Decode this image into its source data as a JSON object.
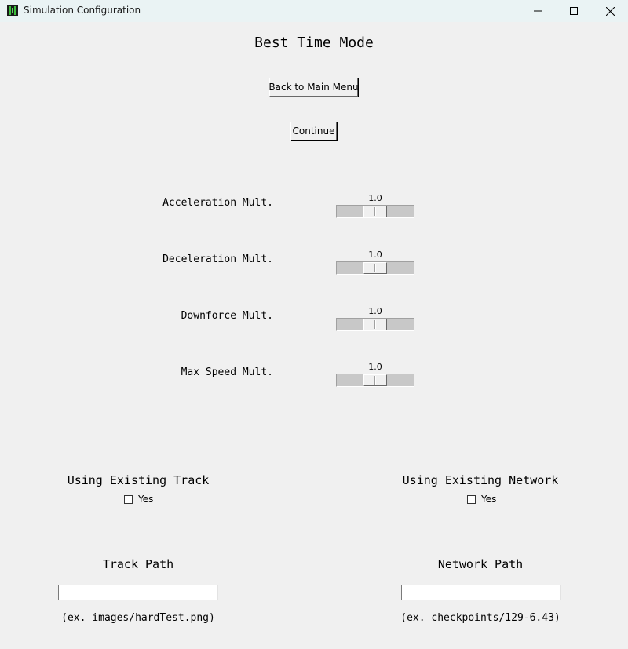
{
  "window": {
    "title": "Simulation Configuration",
    "icon": "app-icon",
    "controls": [
      "minimize-icon",
      "maximize-icon",
      "close-icon"
    ]
  },
  "page": {
    "heading": "Best Time Mode",
    "back_button_label": "Back to Main Menu",
    "continue_button_label": "Continue"
  },
  "sliders": [
    {
      "label": "Acceleration Mult.",
      "value": "1.0",
      "level": 0.5
    },
    {
      "label": "Deceleration Mult.",
      "value": "1.0",
      "level": 0.5
    },
    {
      "label": "Downforce Mult.",
      "value": "1.0",
      "level": 0.5
    },
    {
      "label": "Max Speed Mult.",
      "value": "1.0",
      "level": 0.5
    }
  ],
  "track": {
    "heading": "Using Existing Track",
    "checkbox_label": "Yes",
    "checked": false,
    "path_heading": "Track Path",
    "path_value": "",
    "hint": "(ex. images/hardTest.png)"
  },
  "network": {
    "heading": "Using Existing Network",
    "checkbox_label": "Yes",
    "checked": false,
    "path_heading": "Network Path",
    "path_value": "",
    "hint": "(ex. checkpoints/129-6.43)"
  },
  "colors": {
    "background": "#f0f0f0",
    "titlebar": "#eaf3f4",
    "trough": "#c8c8c8"
  }
}
